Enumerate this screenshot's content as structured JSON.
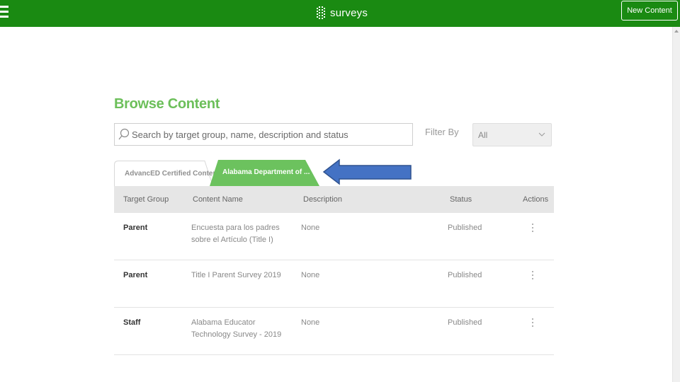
{
  "header": {
    "app_name": "surveys",
    "menu_icon": "hamburger-menu-icon",
    "logo_icon": "surveys-logo-icon",
    "new_content_label": "New Content",
    "bar_color": "#1a8a12"
  },
  "page": {
    "title": "Browse Content",
    "title_color": "#6cbf5a"
  },
  "search": {
    "placeholder": "Search by target group, name, description and status",
    "value": "",
    "icon": "search-icon"
  },
  "filter": {
    "label": "Filter By",
    "selected": "All",
    "icon": "chevron-down-icon"
  },
  "tabs": [
    {
      "label": "AdvancED Certified Content",
      "active": false
    },
    {
      "label": "Alabama Department of ...",
      "active": true,
      "color": "#6cc25e"
    }
  ],
  "annotation": {
    "arrow_color": "#4472c4",
    "arrow_outline": "#2f528f"
  },
  "table": {
    "columns": [
      "Target Group",
      "Content Name",
      "Description",
      "Status",
      "Actions"
    ],
    "rows": [
      {
        "target_group": "Parent",
        "content_name": "Encuesta para los padres sobre el Artículo  (Title I)",
        "description": "None",
        "status": "Published",
        "action_icon": "more-vertical-icon"
      },
      {
        "target_group": "Parent",
        "content_name": "Title I Parent Survey 2019",
        "description": "None",
        "status": "Published",
        "action_icon": "more-vertical-icon"
      },
      {
        "target_group": "Staff",
        "content_name": "Alabama Educator Technology Survey - 2019",
        "description": "None",
        "status": "Published",
        "action_icon": "more-vertical-icon"
      }
    ]
  }
}
